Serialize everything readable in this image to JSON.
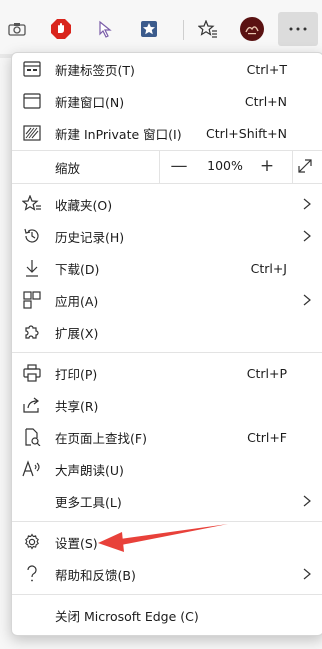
{
  "menu": {
    "group1": [
      {
        "icon": "new-tab-icon",
        "label": "新建标签页(T)",
        "shortcut": "Ctrl+T"
      },
      {
        "icon": "new-window-icon",
        "label": "新建窗口(N)",
        "shortcut": "Ctrl+N"
      },
      {
        "icon": "inprivate-window-icon",
        "label": "新建 InPrivate 窗口(I)",
        "shortcut": "Ctrl+Shift+N"
      }
    ],
    "zoom": {
      "label": "缩放",
      "minus": "—",
      "value": "100%",
      "plus": "+"
    },
    "group2": [
      {
        "icon": "favorites-icon",
        "label": "收藏夹(O)",
        "shortcut": ""
      },
      {
        "icon": "history-icon",
        "label": "历史记录(H)",
        "shortcut": ""
      },
      {
        "icon": "download-icon",
        "label": "下载(D)",
        "shortcut": "Ctrl+J"
      },
      {
        "icon": "apps-icon",
        "label": "应用(A)",
        "shortcut": ""
      },
      {
        "icon": "extensions-icon",
        "label": "扩展(X)",
        "shortcut": ""
      }
    ],
    "group3": [
      {
        "icon": "print-icon",
        "label": "打印(P)",
        "shortcut": "Ctrl+P"
      },
      {
        "icon": "share-icon",
        "label": "共享(R)",
        "shortcut": ""
      },
      {
        "icon": "find-on-page-icon",
        "label": "在页面上查找(F)",
        "shortcut": "Ctrl+F"
      },
      {
        "icon": "read-aloud-icon",
        "label": "大声朗读(U)",
        "shortcut": ""
      },
      {
        "icon": "",
        "label": "更多工具(L)",
        "shortcut": ""
      }
    ],
    "group4": [
      {
        "icon": "settings-icon",
        "label": "设置(S)",
        "shortcut": ""
      },
      {
        "icon": "help-icon",
        "label": "帮助和反馈(B)",
        "shortcut": ""
      }
    ],
    "close": {
      "label": "关闭 Microsoft Edge (C)"
    }
  },
  "toolbar": {
    "icons": [
      "camera-icon",
      "adblock-icon",
      "cursor-extension-icon",
      "star-extension-icon",
      "favorites-collection-icon",
      "profile-avatar-icon",
      "more-menu-icon"
    ]
  },
  "colors": {
    "annotation_arrow": "#e8413a",
    "adblock_red": "#d9241c",
    "avatar_dark": "#5a1212"
  }
}
